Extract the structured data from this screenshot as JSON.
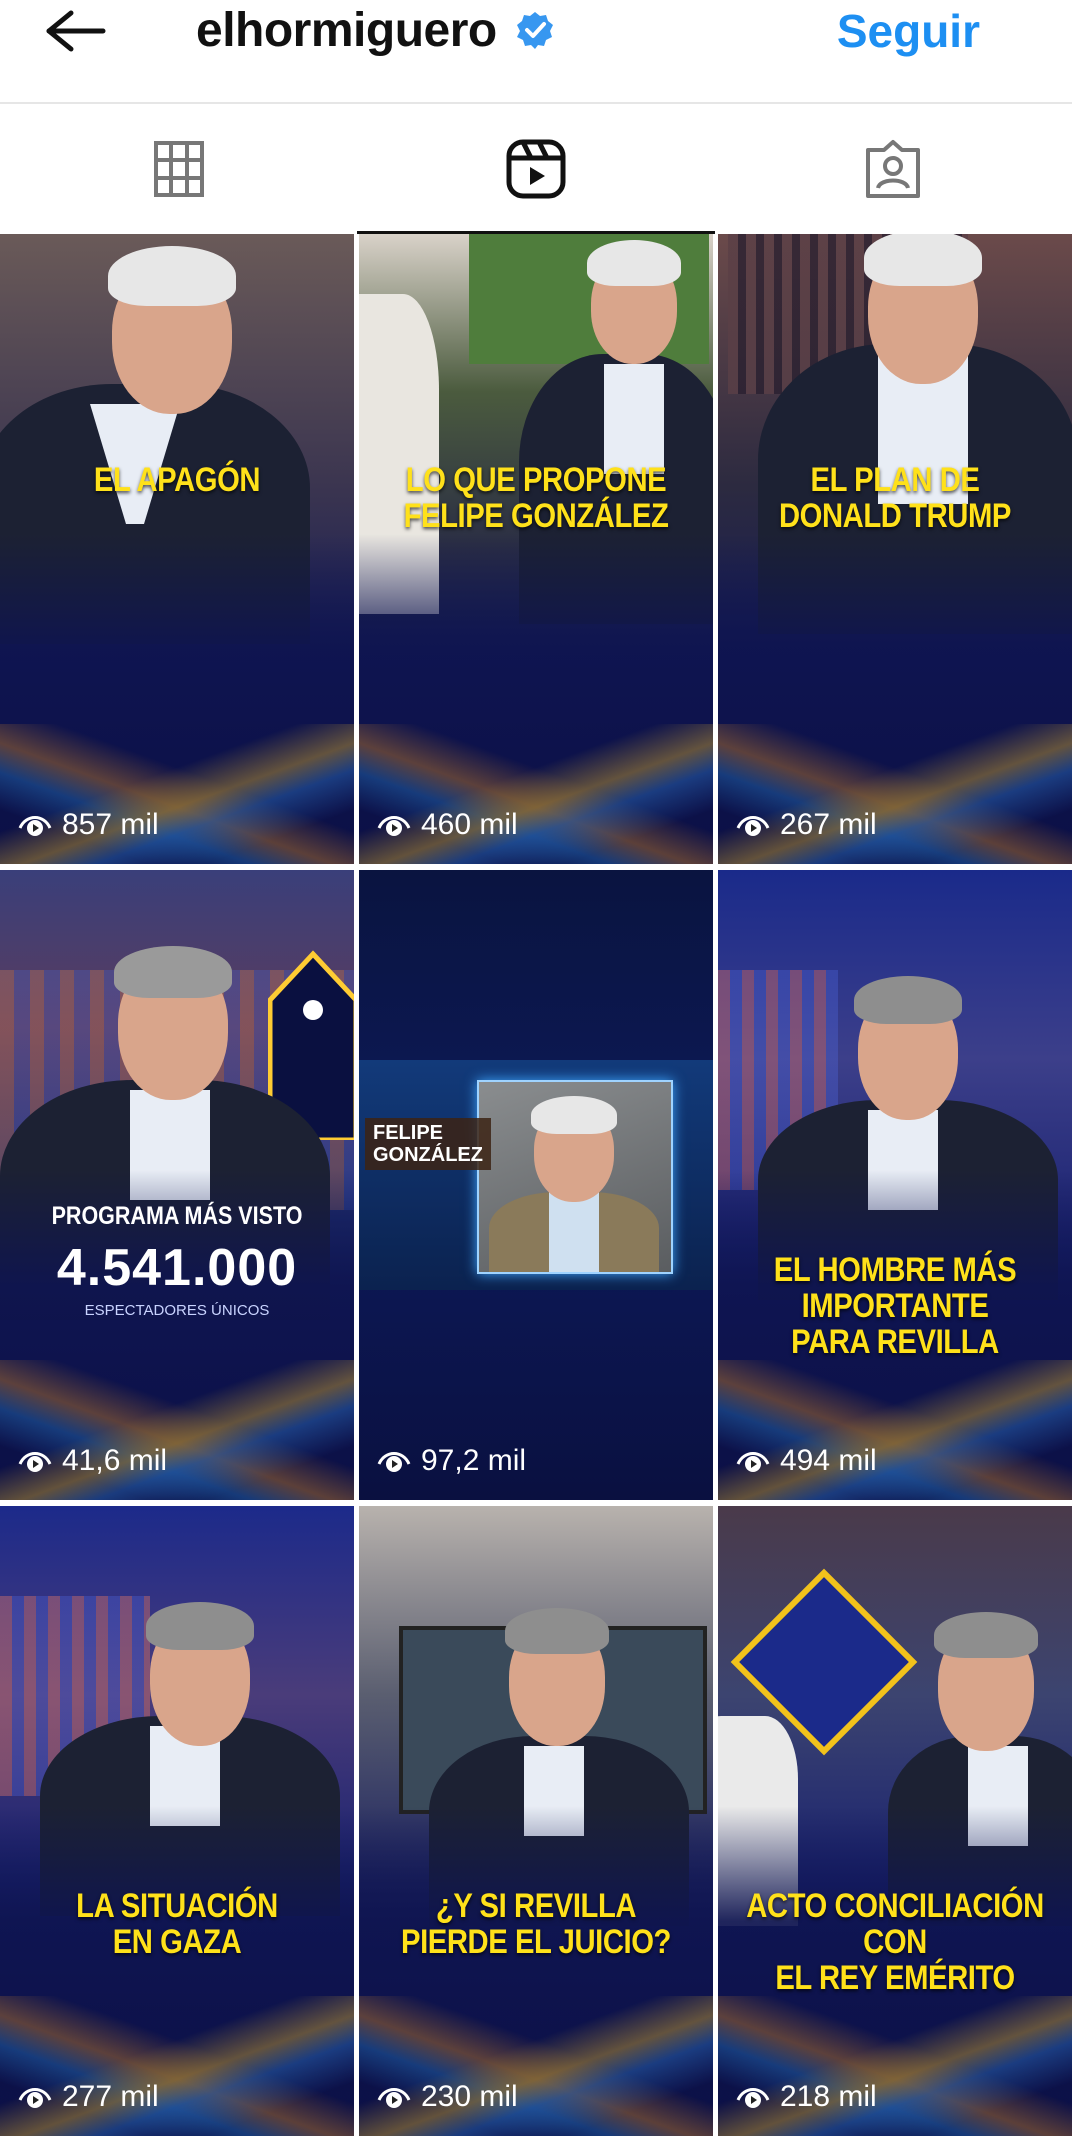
{
  "header": {
    "back_icon": "arrow-left-icon",
    "username": "elhormiguero",
    "verified_icon": "verified-badge-icon",
    "follow_label": "Seguir",
    "accent_color": "#1d8ff2"
  },
  "tabs": [
    {
      "icon": "grid-icon",
      "active": false
    },
    {
      "icon": "reels-icon",
      "active": true
    },
    {
      "icon": "tagged-icon",
      "active": false
    }
  ],
  "reels": [
    {
      "caption": "EL APAGÓN",
      "views": "857 mil"
    },
    {
      "caption": "LO QUE PROPONE\nFELIPE GONZÁLEZ",
      "views": "460 mil"
    },
    {
      "caption": "EL PLAN DE\nDONALD TRUMP",
      "views": "267 mil"
    },
    {
      "caption": "",
      "views": "41,6 mil",
      "stats": {
        "title": "PROGRAMA MÁS VISTO",
        "number": "4.541.000",
        "subtitle": "ESPECTADORES ÚNICOS"
      }
    },
    {
      "caption": "",
      "views": "97,2 mil",
      "name_label": "FELIPE\nGONZÁLEZ"
    },
    {
      "caption": "EL HOMBRE MÁS\nIMPORTANTE\nPARA REVILLA",
      "views": "494 mil"
    },
    {
      "caption": "LA SITUACIÓN\nEN GAZA",
      "views": "277 mil"
    },
    {
      "caption": "¿Y SI REVILLA\nPIERDE EL JUICIO?",
      "views": "230 mil"
    },
    {
      "caption": "ACTO CONCILIACIÓN\nCON\nEL REY EMÉRITO",
      "views": "218 mil"
    }
  ],
  "view_icon": "eye-play-icon",
  "caption_color": "#ffe11a"
}
